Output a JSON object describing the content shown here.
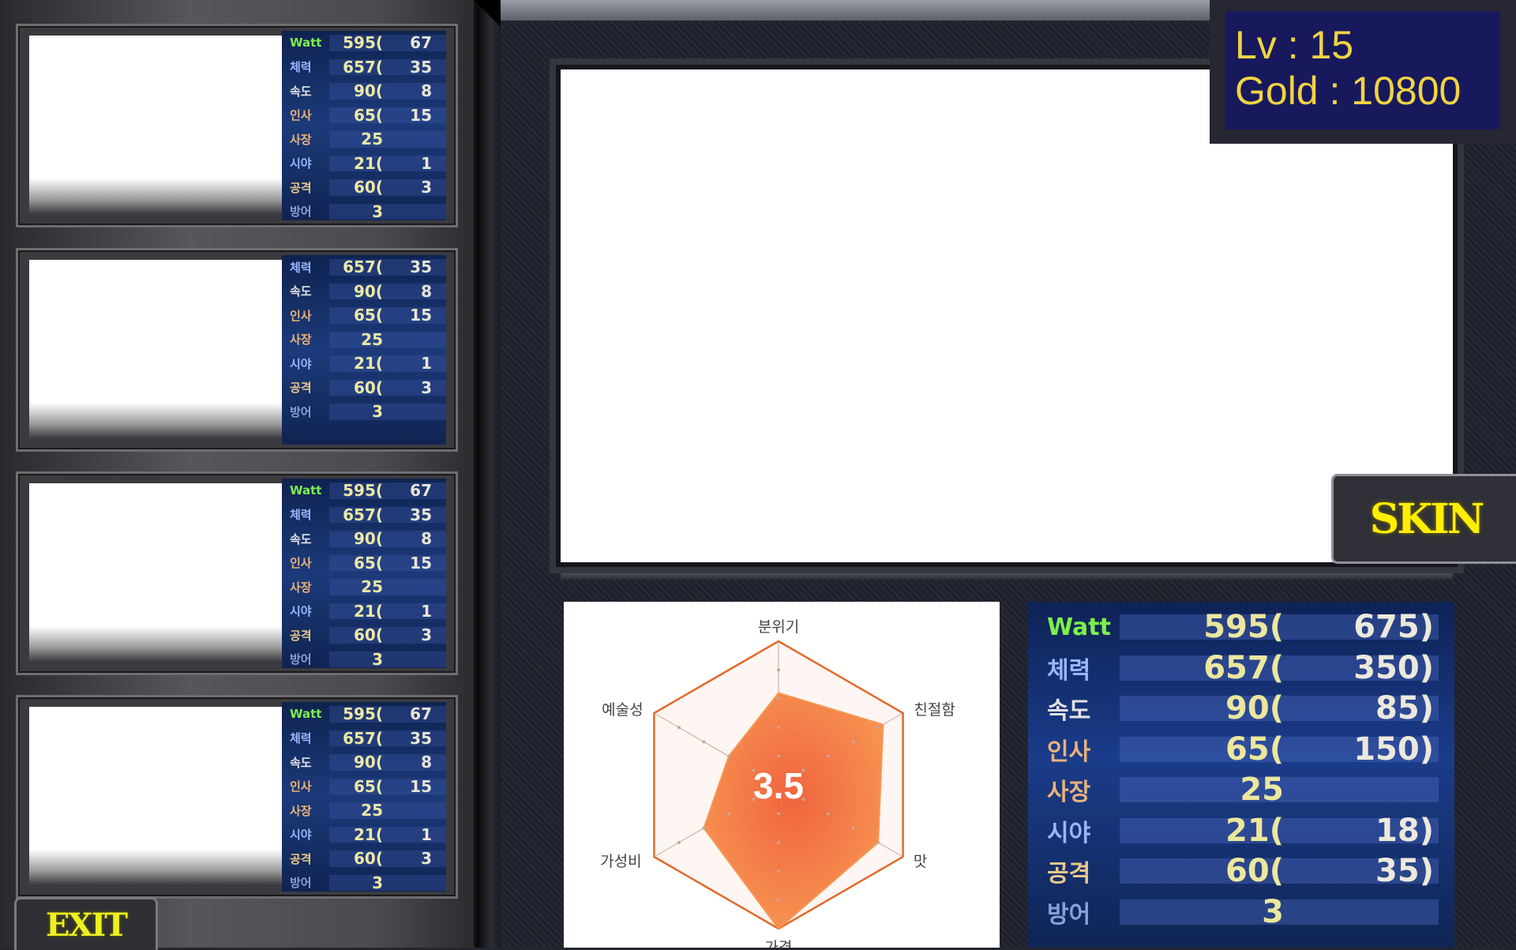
{
  "player": {
    "level_text": "Lv : 15",
    "gold_text": "Gold : 10800"
  },
  "buttons": {
    "skin_label": "SKIN",
    "exit_label": "EXIT"
  },
  "stat_labels": [
    {
      "label": "Watt",
      "color": "#7cf04a"
    },
    {
      "label": "체력",
      "color": "#9ab6ff"
    },
    {
      "label": "속도",
      "color": "#e2e2e2"
    },
    {
      "label": "인사",
      "color": "#e8b37a"
    },
    {
      "label": "사장",
      "color": "#e8b37a"
    },
    {
      "label": "시야",
      "color": "#9ab6ff"
    },
    {
      "label": "공격",
      "color": "#e8c98a"
    },
    {
      "label": "방어",
      "color": "#8aa0d6"
    }
  ],
  "slots": [
    {
      "stats": [
        {
          "value": "595(",
          "paren": "67"
        },
        {
          "value": "657(",
          "paren": "35"
        },
        {
          "value": "90(",
          "paren": "8"
        },
        {
          "value": "65(",
          "paren": "15"
        },
        {
          "value": "25",
          "paren": ""
        },
        {
          "value": "21(",
          "paren": "1"
        },
        {
          "value": "60(",
          "paren": "3"
        },
        {
          "value": "3",
          "paren": ""
        }
      ]
    },
    {
      "stats": [
        {
          "value": "657(",
          "paren": "35"
        },
        {
          "value": "90(",
          "paren": "8"
        },
        {
          "value": "65(",
          "paren": "15"
        },
        {
          "value": "25",
          "paren": ""
        },
        {
          "value": "21(",
          "paren": "1"
        },
        {
          "value": "60(",
          "paren": "3"
        },
        {
          "value": "3",
          "paren": ""
        }
      ]
    },
    {
      "stats": [
        {
          "value": "595(",
          "paren": "67"
        },
        {
          "value": "657(",
          "paren": "35"
        },
        {
          "value": "90(",
          "paren": "8"
        },
        {
          "value": "65(",
          "paren": "15"
        },
        {
          "value": "25",
          "paren": ""
        },
        {
          "value": "21(",
          "paren": "1"
        },
        {
          "value": "60(",
          "paren": "3"
        },
        {
          "value": "3",
          "paren": ""
        }
      ]
    },
    {
      "stats": [
        {
          "value": "595(",
          "paren": "67"
        },
        {
          "value": "657(",
          "paren": "35"
        },
        {
          "value": "90(",
          "paren": "8"
        },
        {
          "value": "65(",
          "paren": "15"
        },
        {
          "value": "25",
          "paren": ""
        },
        {
          "value": "21(",
          "paren": "1"
        },
        {
          "value": "60(",
          "paren": "3"
        },
        {
          "value": "3",
          "paren": ""
        }
      ]
    }
  ],
  "main_stats": [
    {
      "label": "Watt",
      "value": "595(",
      "paren": "675)"
    },
    {
      "label": "체력",
      "value": "657(",
      "paren": "350)"
    },
    {
      "label": "속도",
      "value": "90(",
      "paren": "85)"
    },
    {
      "label": "인사",
      "value": "65(",
      "paren": "150)"
    },
    {
      "label": "사장",
      "value": "25",
      "paren": ""
    },
    {
      "label": "시야",
      "value": "21(",
      "paren": "18)"
    },
    {
      "label": "공격",
      "value": "60(",
      "paren": "35)"
    },
    {
      "label": "방어",
      "value": "3",
      "paren": ""
    }
  ],
  "chart_data": {
    "type": "radar",
    "center_label": "3.5",
    "axes": [
      "분위기",
      "친절함",
      "맛",
      "가격",
      "가성비",
      "예술성"
    ],
    "values": [
      3.2,
      4.2,
      4.0,
      5.0,
      3.0,
      2.0
    ],
    "max": 5,
    "rings": 5,
    "fill_color": "#f7914a",
    "line_color": "#e36a2c"
  }
}
